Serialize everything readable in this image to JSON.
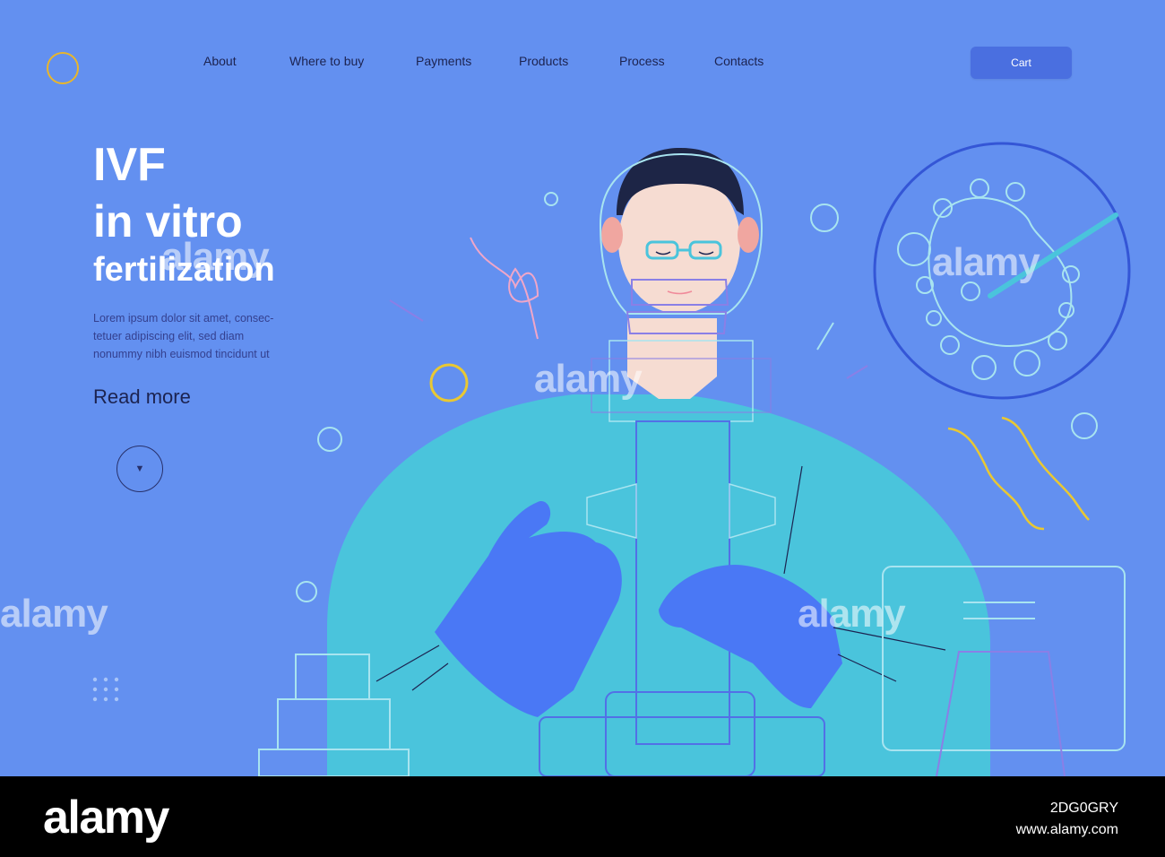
{
  "nav": {
    "items": [
      {
        "label": "About"
      },
      {
        "label": "Where to buy"
      },
      {
        "label": "Payments"
      },
      {
        "label": "Products"
      },
      {
        "label": "Process"
      },
      {
        "label": "Contacts"
      }
    ],
    "cart_label": "Cart"
  },
  "hero": {
    "title_line1": "IVF",
    "title_line2": "in vitro",
    "title_line3": "fertilization",
    "description_lines": [
      "Lorem ipsum dolor sit amet, consec-",
      "tetuer adipiscing elit, sed diam",
      "nonummy nibh euismod tincidunt ut"
    ],
    "read_more": "Read more",
    "scroll_symbol": "▼"
  },
  "watermark": {
    "text": "alamy",
    "image_id": "2DG0GRY",
    "site": "www.alamy.com"
  },
  "colors": {
    "background": "#6390f0",
    "accent_button": "#4a6fe0",
    "title_text": "#ffffff",
    "nav_text": "#1c2350",
    "body_text": "#34408f",
    "scrub_teal": "#4ac4dc",
    "glove_blue": "#4a78f5",
    "ring_yellow": "#e9c832"
  }
}
